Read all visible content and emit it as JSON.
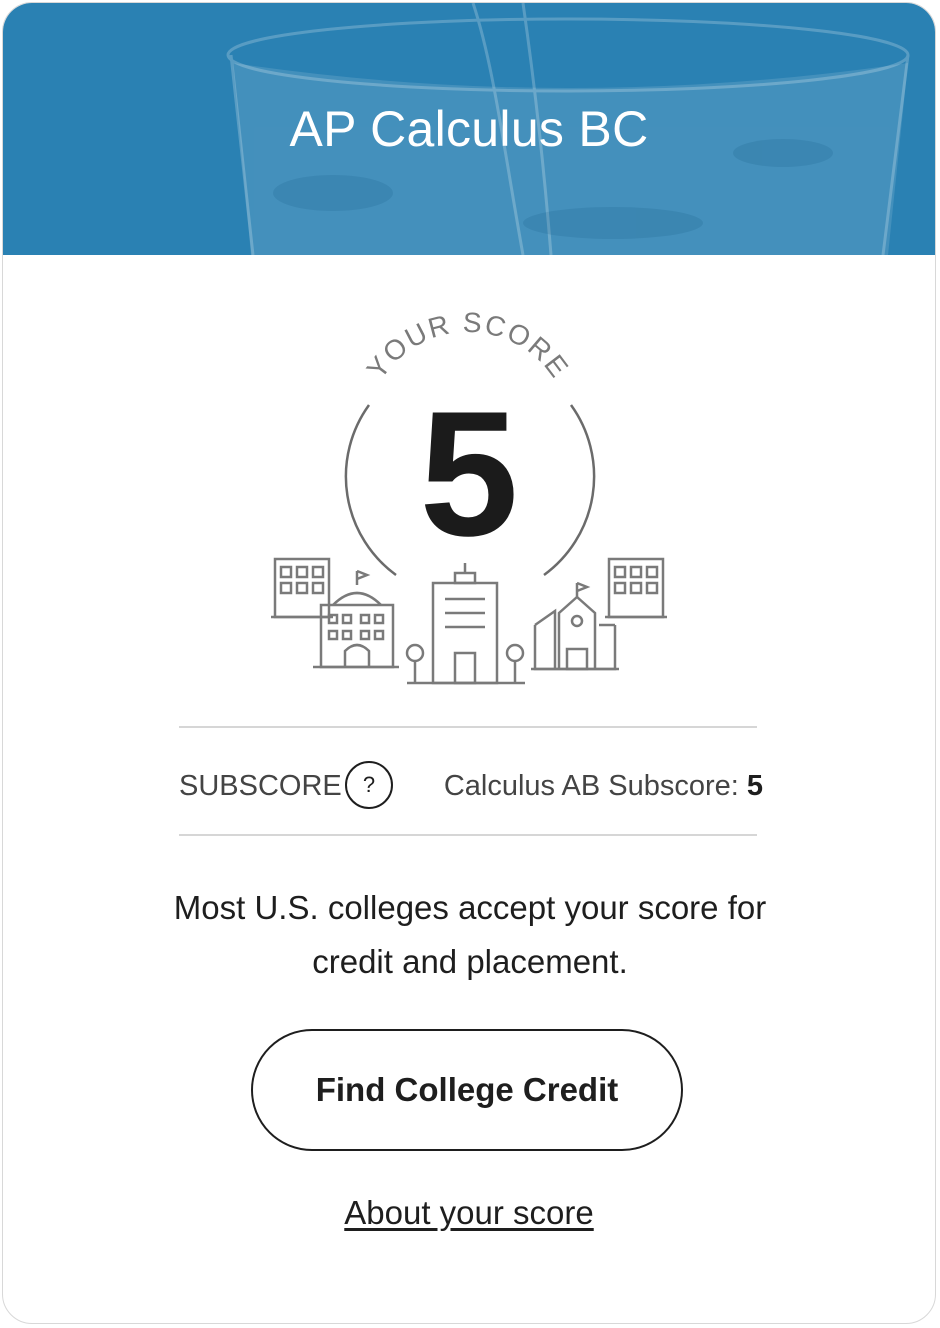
{
  "header": {
    "title": "AP Calculus BC",
    "background_color": "#2a81b3"
  },
  "score": {
    "arc_label": "YOUR SCORE",
    "value": "5"
  },
  "subscore": {
    "label": "SUBSCORE",
    "help_icon_glyph": "?",
    "name": "Calculus AB Subscore:",
    "value": "5"
  },
  "message": {
    "text": "Most U.S. colleges accept your score for credit and placement."
  },
  "actions": {
    "primary_label": "Find College Credit",
    "link_label": "About your score"
  },
  "icons": {
    "illustration": "college-buildings-icon",
    "help": "question-circle-icon"
  }
}
